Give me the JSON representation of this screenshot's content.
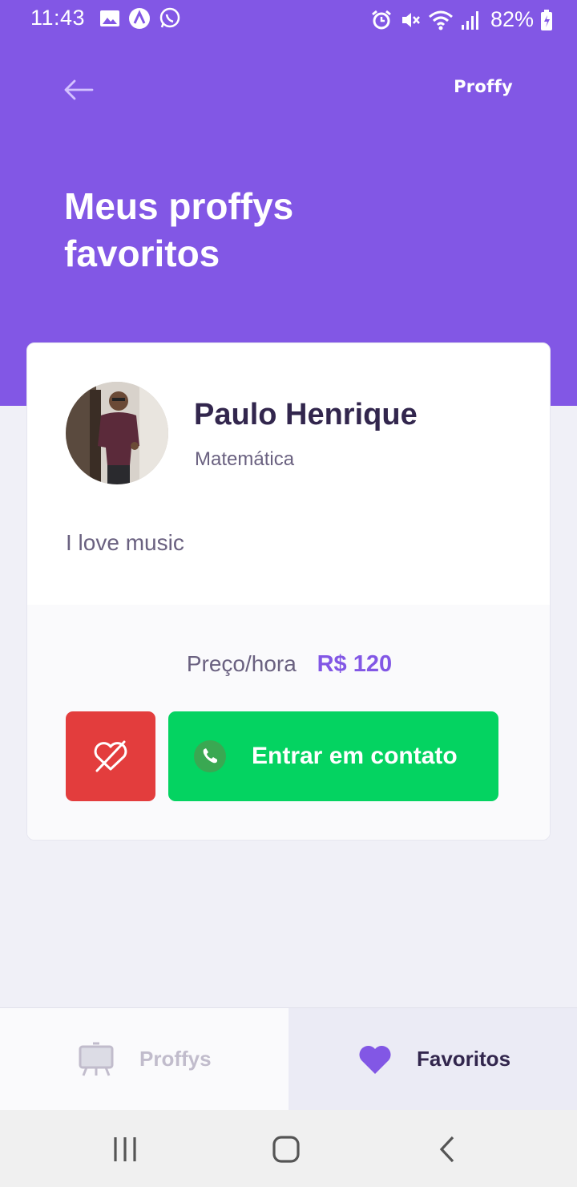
{
  "status_bar": {
    "time": "11:43",
    "battery": "82%",
    "left_icons": [
      "gallery-icon",
      "a-icon",
      "whatsapp-icon"
    ],
    "right_icons": [
      "alarm-icon",
      "mute-icon",
      "wifi-icon",
      "signal-icon",
      "battery-icon"
    ]
  },
  "header": {
    "logo": "Proffy",
    "title": "Meus proffys favoritos",
    "background_color": "#8257E5"
  },
  "teacher_card": {
    "name": "Paulo Henrique",
    "subject": "Matemática",
    "bio": "I love music",
    "price_label": "Preço/hora",
    "price_value": "R$ 120",
    "contact_button": "Entrar em contato",
    "unfavorite_color": "#E33D3D",
    "contact_color": "#04D361"
  },
  "tabs": [
    {
      "label": "Proffys",
      "icon": "easel-icon",
      "active": false
    },
    {
      "label": "Favoritos",
      "icon": "heart-icon",
      "active": true
    }
  ],
  "system_nav": [
    "recents-icon",
    "home-icon",
    "back-icon"
  ]
}
